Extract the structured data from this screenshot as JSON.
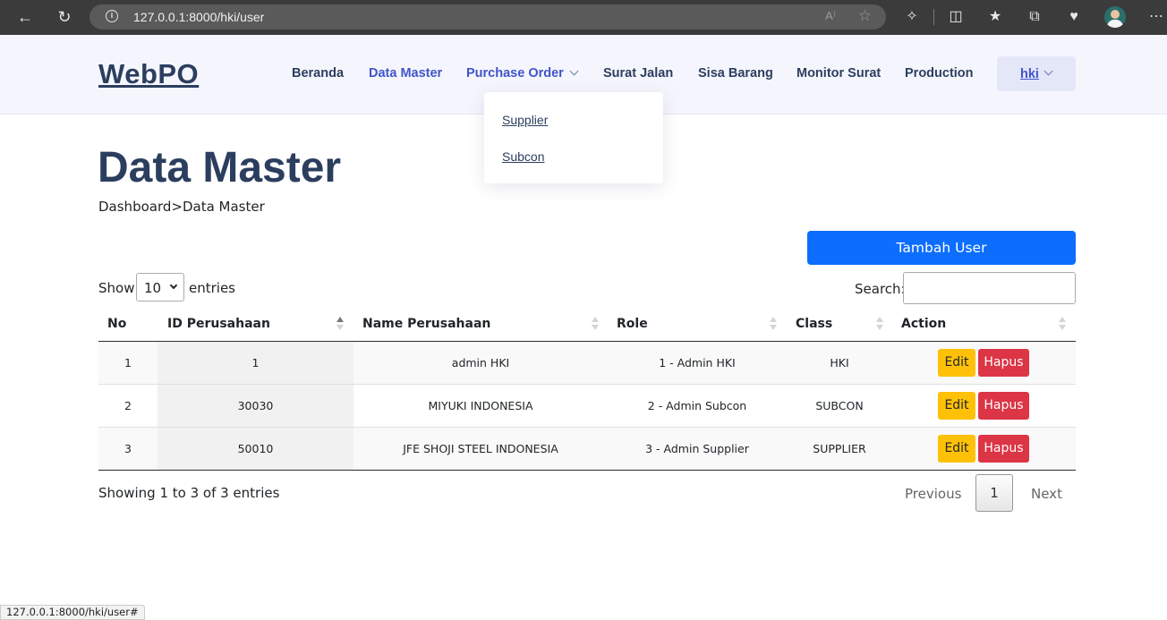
{
  "browser": {
    "url": "127.0.0.1:8000/hki/user",
    "status_url": "127.0.0.1:8000/hki/user#"
  },
  "site": {
    "logo": "WebPO",
    "nav": [
      {
        "label": "Beranda"
      },
      {
        "label": "Data Master"
      },
      {
        "label": "Purchase Order"
      },
      {
        "label": "Surat Jalan"
      },
      {
        "label": "Sisa Barang"
      },
      {
        "label": "Monitor Surat"
      },
      {
        "label": "Production"
      }
    ],
    "user": "hki",
    "dropdown": [
      "Supplier",
      "Subcon"
    ]
  },
  "page": {
    "title": "Data Master",
    "breadcrumb": "Dashboard>Data Master",
    "add_button": "Tambah User"
  },
  "table_controls": {
    "show": "Show",
    "page_size": "10",
    "entries": "entries",
    "search": "Search:"
  },
  "table": {
    "columns": [
      "No",
      "ID Perusahaan",
      "Name Perusahaan",
      "Role",
      "Class",
      "Action"
    ],
    "rows": [
      {
        "no": "1",
        "id": "1",
        "name": "admin HKI",
        "role": "1 - Admin HKI",
        "class": "HKI"
      },
      {
        "no": "2",
        "id": "30030",
        "name": "MIYUKI INDONESIA",
        "role": "2 - Admin Subcon",
        "class": "SUBCON"
      },
      {
        "no": "3",
        "id": "50010",
        "name": "JFE SHOJI STEEL INDONESIA",
        "role": "3 - Admin Supplier",
        "class": "SUPPLIER"
      }
    ],
    "edit_label": "Edit",
    "delete_label": "Hapus"
  },
  "footer": {
    "info": "Showing 1 to 3 of 3 entries",
    "previous": "Previous",
    "current_page": "1",
    "next": "Next"
  },
  "colors": {
    "primary": "#0d6efd",
    "warning": "#ffc107",
    "danger": "#dc3545",
    "nav_active": "#4154c8",
    "heading": "#2c3e5e"
  }
}
